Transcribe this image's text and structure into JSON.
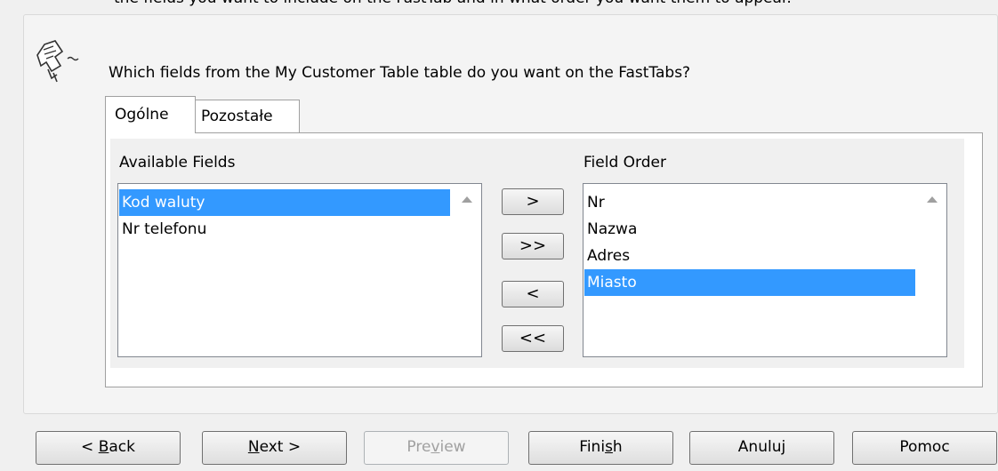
{
  "header": {
    "cut_text": "the fields you want to include on the FastTab and in what order you want them to appear.",
    "question": "Which fields from the My Customer Table table do you want on the FastTabs?"
  },
  "icons": {
    "wizard": "wizard-page-icon",
    "scroll": "scroll-up-arrow-icon"
  },
  "tabs": [
    {
      "label": "Ogólne",
      "active": true
    },
    {
      "label": "Pozostałe",
      "active": false
    }
  ],
  "available_fields": {
    "label": "Available Fields",
    "items": [
      {
        "label": "Kod waluty",
        "selected": true
      },
      {
        "label": "Nr telefonu",
        "selected": false
      }
    ]
  },
  "field_order": {
    "label": "Field Order",
    "items": [
      {
        "label": "Nr",
        "selected": false
      },
      {
        "label": "Nazwa",
        "selected": false
      },
      {
        "label": "Adres",
        "selected": false
      },
      {
        "label": "Miasto",
        "selected": true
      }
    ]
  },
  "move_buttons": {
    "add": ">",
    "add_all": ">>",
    "remove": "<",
    "remove_all": "<<"
  },
  "nav_buttons": {
    "back": {
      "pre": "< ",
      "key": "B",
      "post": "ack"
    },
    "next": {
      "pre": "",
      "key": "N",
      "post": "ext >"
    },
    "preview": {
      "pre": "Pre",
      "key": "v",
      "post": "iew",
      "disabled": true
    },
    "finish": {
      "pre": "Fini",
      "key": "s",
      "post": "h"
    },
    "cancel": "Anuluj",
    "help": "Pomoc"
  },
  "colors": {
    "selection": "#3399ff",
    "window_bg": "#f0f0f0"
  }
}
